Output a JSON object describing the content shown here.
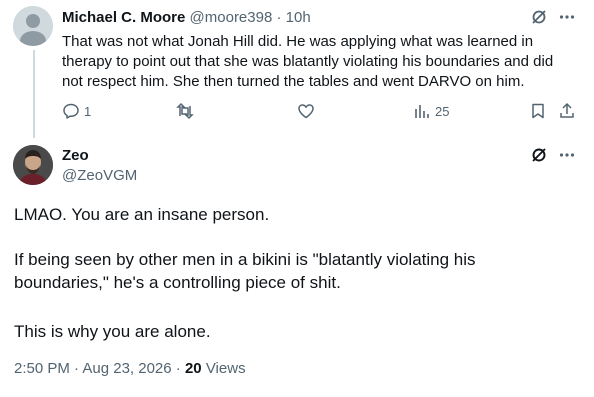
{
  "reply": {
    "name": "Michael C. Moore",
    "handle": "@moore398",
    "separator": "·",
    "time": "10h",
    "text": "That was not what Jonah Hill did. He was applying what was learned in therapy to point out that she was blatantly violating his boundaries and did not respect him. She then turned the tables and went DARVO on him.",
    "actions": {
      "reply_count": "1",
      "retweet_count": "",
      "like_count": "",
      "views_count": "25"
    }
  },
  "tweet": {
    "name": "Zeo",
    "handle": "@ZeoVGM",
    "paragraph1": "LMAO. You are an insane person.",
    "paragraph2": "If being seen by other men in a bikini is \"blatantly violating his boundaries,\" he's a controlling piece of shit.",
    "paragraph3": "This is why you are alone.",
    "timestamp": "2:50 PM · Aug 23, 2026",
    "separator": "·",
    "views_count": "20",
    "views_label": "Views"
  },
  "colors": {
    "text": "#0f1419",
    "muted": "#536471",
    "thread_line": "#cfd9de"
  },
  "icons": [
    "grok-icon",
    "more-icon",
    "reply-icon",
    "retweet-icon",
    "like-icon",
    "views-icon",
    "bookmark-icon",
    "share-icon"
  ]
}
